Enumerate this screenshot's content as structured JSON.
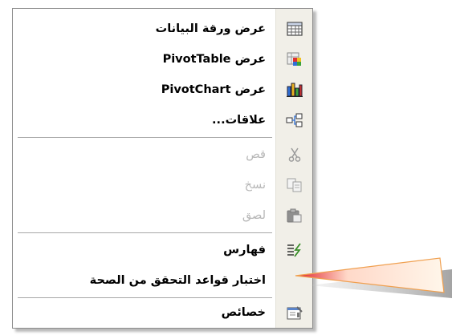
{
  "menu": {
    "items": [
      {
        "label": "عرض ورقة البيانات",
        "icon": "datasheet-view-icon",
        "disabled": false
      },
      {
        "label": "عرض PivotTable",
        "icon": "pivottable-icon",
        "disabled": false
      },
      {
        "label": "عرض PivotChart",
        "icon": "pivotchart-icon",
        "disabled": false
      },
      {
        "label": "علاقات...",
        "icon": "relationships-icon",
        "disabled": false
      },
      {
        "label": "قص",
        "icon": "cut-icon",
        "disabled": true
      },
      {
        "label": "نسخ",
        "icon": "copy-icon",
        "disabled": true
      },
      {
        "label": "لصق",
        "icon": "paste-icon",
        "disabled": true
      },
      {
        "label": "فهارس",
        "icon": "indexes-icon",
        "disabled": false
      },
      {
        "label": "اختبار قواعد التحقق من الصحة",
        "icon": "",
        "disabled": false
      },
      {
        "label": "خصائص",
        "icon": "properties-icon",
        "disabled": false
      }
    ]
  },
  "colors": {
    "callout_border": "#f0a050",
    "callout_fill": "#fff3e0",
    "arrow_red": "#e0202a",
    "disabled_text": "#b7b7b7",
    "icon_strip": "#f1efe8"
  }
}
